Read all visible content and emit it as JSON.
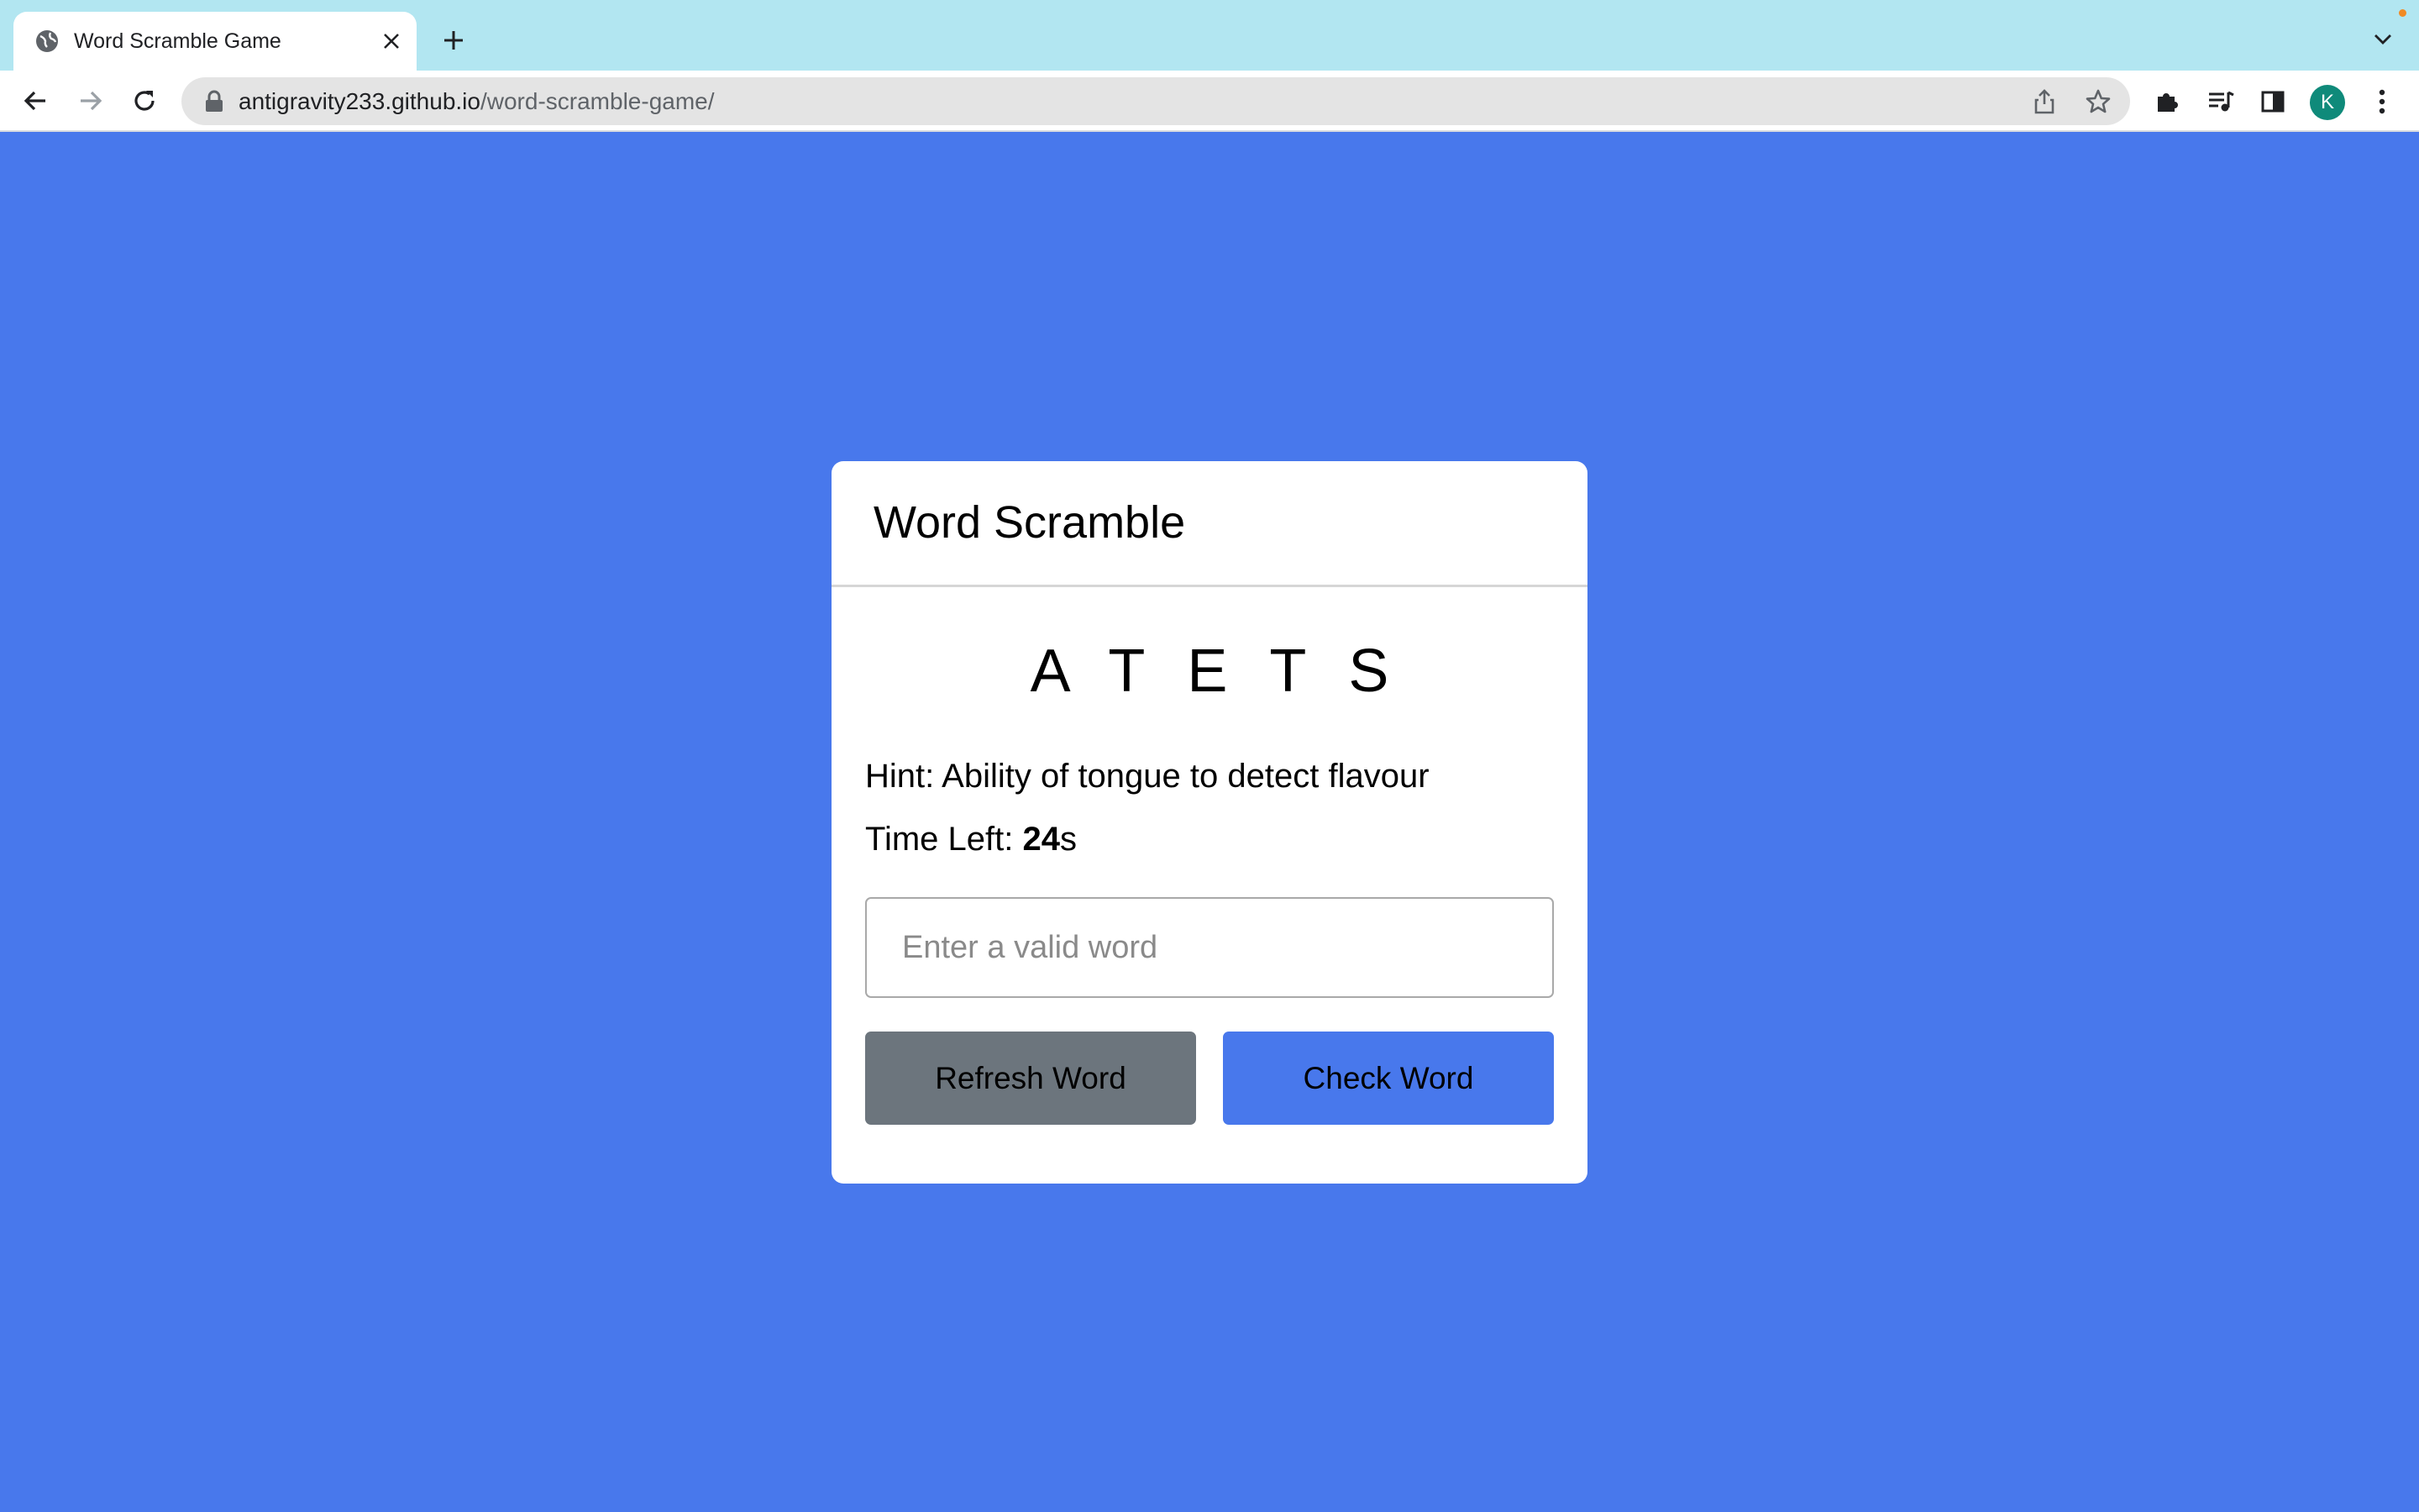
{
  "browser": {
    "tab_title": "Word Scramble Game",
    "url_host": "antigravity233.github.io",
    "url_path": "/word-scramble-game/",
    "avatar_letter": "K",
    "icons": {
      "favicon": "globe-icon",
      "close": "close-icon",
      "new_tab": "plus-icon",
      "back": "back-arrow-icon",
      "forward": "forward-arrow-icon",
      "reload": "reload-icon",
      "lock": "lock-icon",
      "share": "share-icon",
      "bookmark": "star-icon",
      "extensions": "puzzle-icon",
      "media": "media-queue-icon",
      "side_panel": "side-panel-icon",
      "menu": "kebab-menu-icon",
      "tab_search": "chevron-down-icon"
    },
    "colors": {
      "tabstrip": "#b2e6f1",
      "avatar": "#0f8a7a"
    }
  },
  "game": {
    "title": "Word Scramble",
    "scrambled_word": "ATETS",
    "hint_label": "Hint:",
    "hint_text": "Ability of tongue to detect flavour",
    "timer_label": "Time Left:",
    "timer_value": "24",
    "timer_unit": "s",
    "input_placeholder": "Enter a valid word",
    "input_value": "",
    "refresh_label": "Refresh Word",
    "check_label": "Check Word"
  },
  "colors": {
    "page_background": "#4878ec",
    "refresh_button": "#6c757d",
    "check_button": "#4878ec",
    "card_background": "#ffffff"
  }
}
